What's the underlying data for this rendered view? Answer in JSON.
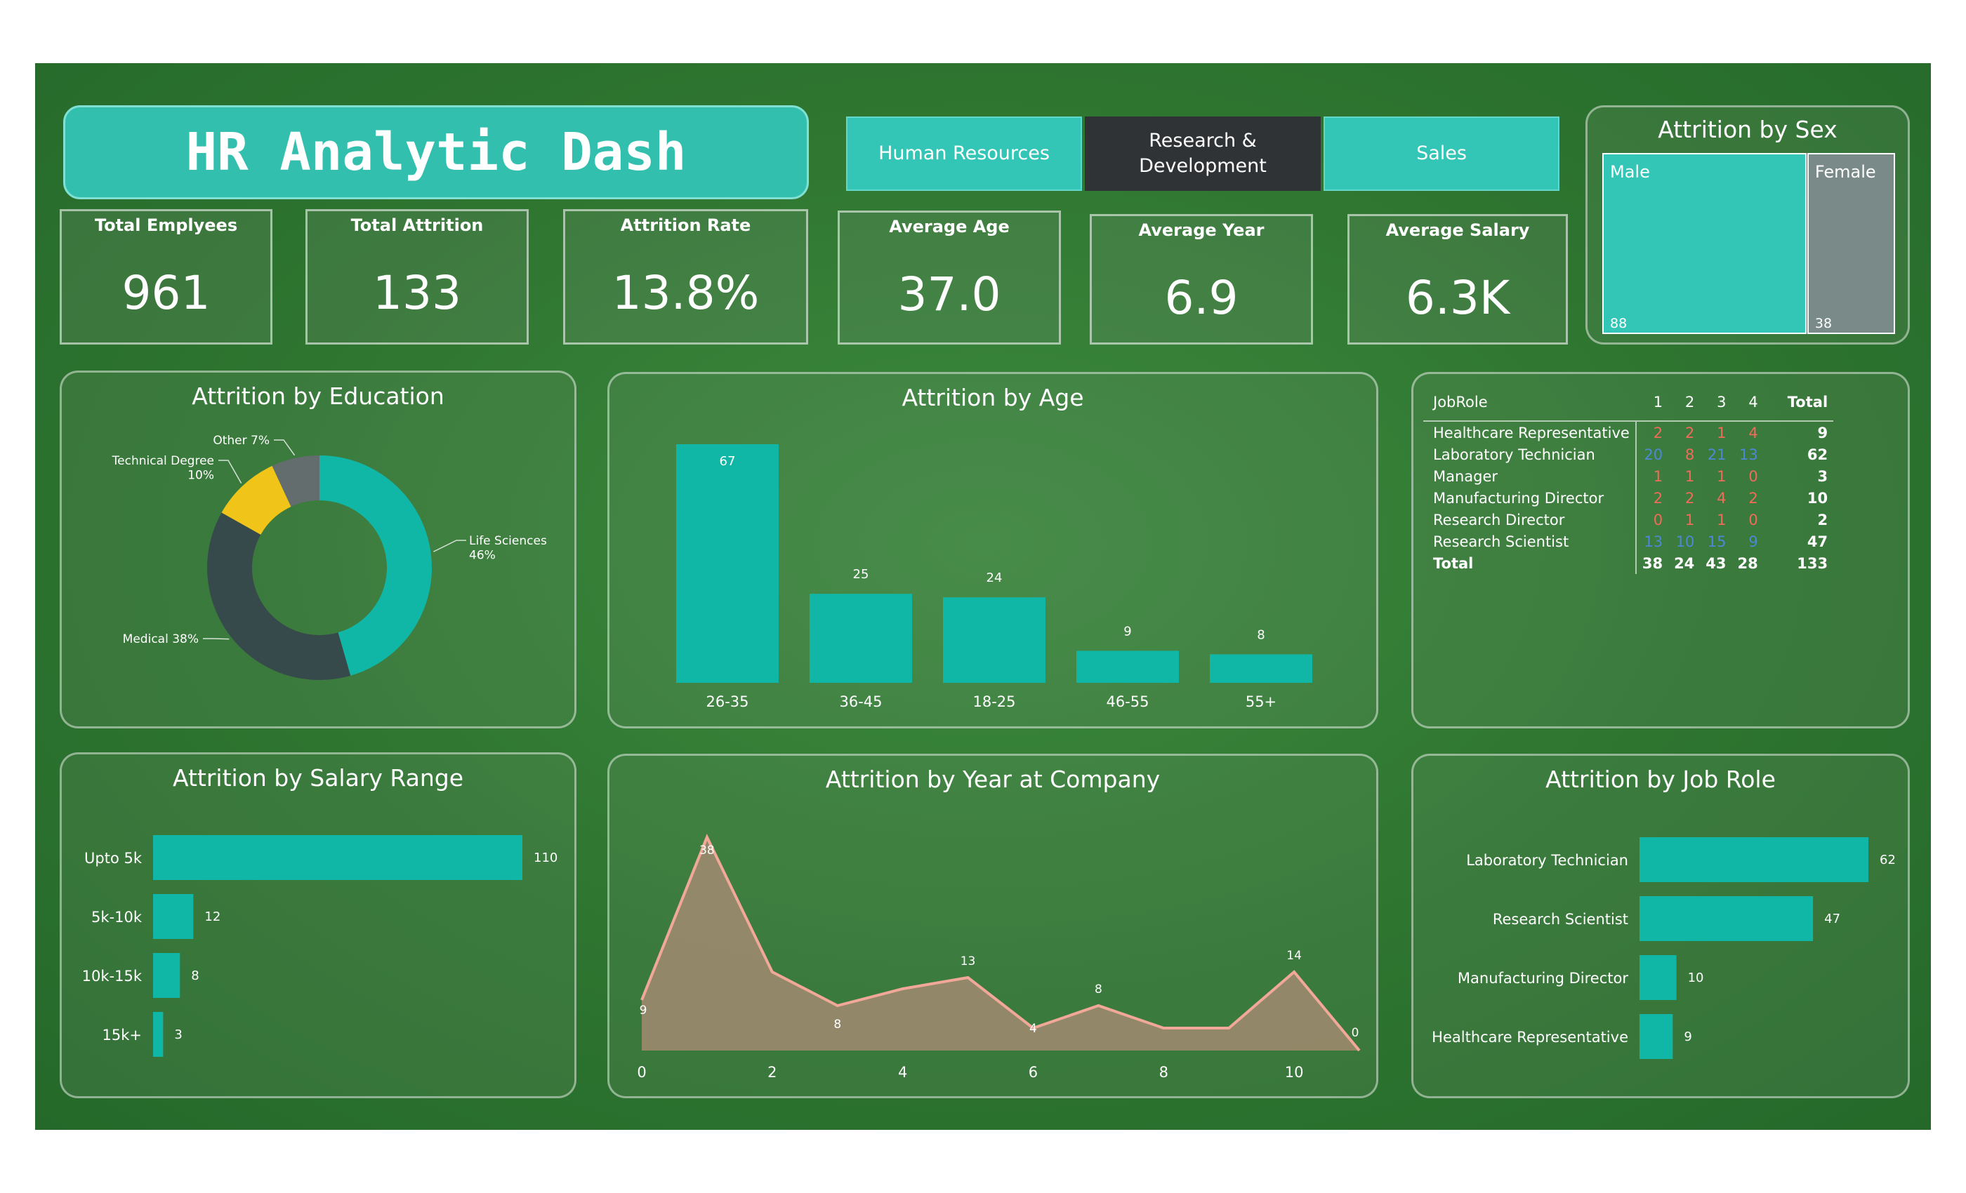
{
  "title": "HR Analytic Dash",
  "departments": [
    "Human Resources",
    "Research &\nDevelopment",
    "Sales"
  ],
  "colors": {
    "teal": "#11b7a6",
    "teal_light": "#33c6b6",
    "dark_button": "#2f3336",
    "grey": "#7a8a89",
    "line": "#f2a899",
    "area": "#9c8a6e"
  },
  "kpis": [
    {
      "label": "Total Emplyees",
      "value": "961"
    },
    {
      "label": "Total Attrition",
      "value": "133"
    },
    {
      "label": "Attrition Rate",
      "value": "13.8%"
    },
    {
      "label": "Average Age",
      "value": "37.0"
    },
    {
      "label": "Average Year",
      "value": "6.9"
    },
    {
      "label": "Average Salary",
      "value": "6.3K"
    }
  ],
  "chart_data": [
    {
      "type": "treemap",
      "title": "Attrition by Sex",
      "categories": [
        "Male",
        "Female"
      ],
      "values": [
        88,
        38
      ]
    },
    {
      "type": "pie",
      "title": "Attrition by Education",
      "categories": [
        "Life Sciences",
        "Medical",
        "Technical Degree",
        "Other"
      ],
      "values": [
        46,
        38,
        10,
        7
      ],
      "labels": [
        "Life Sciences\n46%",
        "Medical 38%",
        "Technical Degree\n10%",
        "Other 7%"
      ]
    },
    {
      "type": "bar",
      "title": "Attrition by Age",
      "categories": [
        "26-35",
        "36-45",
        "18-25",
        "46-55",
        "55+"
      ],
      "values": [
        67,
        25,
        24,
        9,
        8
      ]
    },
    {
      "type": "table",
      "columns": [
        "JobRole",
        "1",
        "2",
        "3",
        "4",
        "Total"
      ],
      "rows": [
        [
          "Healthcare Representative",
          "2",
          "2",
          "1",
          "4",
          "9"
        ],
        [
          "Laboratory Technician",
          "20",
          "8",
          "21",
          "13",
          "62"
        ],
        [
          "Manager",
          "1",
          "1",
          "1",
          "0",
          "3"
        ],
        [
          "Manufacturing Director",
          "2",
          "2",
          "4",
          "2",
          "10"
        ],
        [
          "Research Director",
          "0",
          "1",
          "1",
          "0",
          "2"
        ],
        [
          "Research Scientist",
          "13",
          "10",
          "15",
          "9",
          "47"
        ]
      ],
      "total_row": [
        "Total",
        "38",
        "24",
        "43",
        "28",
        "133"
      ]
    },
    {
      "type": "bar",
      "orientation": "horizontal",
      "title": "Attrition by Salary Range",
      "categories": [
        "Upto 5k",
        "5k-10k",
        "10k-15k",
        "15k+"
      ],
      "values": [
        110,
        12,
        8,
        3
      ]
    },
    {
      "type": "area",
      "title": "Attrition by Year at Company",
      "x": [
        0,
        1,
        2,
        3,
        4,
        5,
        6,
        7,
        8,
        9,
        10,
        11
      ],
      "y": [
        9,
        38,
        14,
        8,
        11,
        13,
        4,
        8,
        4,
        4,
        14,
        0
      ],
      "point_labels": [
        {
          "x": 0,
          "text": "9"
        },
        {
          "x": 1,
          "text": "38"
        },
        {
          "x": 3,
          "text": "8"
        },
        {
          "x": 5,
          "text": "13"
        },
        {
          "x": 6,
          "text": "4"
        },
        {
          "x": 7,
          "text": "8"
        },
        {
          "x": 10,
          "text": "14"
        },
        {
          "x": 11,
          "text": "0"
        }
      ],
      "xticks": [
        "0",
        "2",
        "4",
        "6",
        "8",
        "10"
      ],
      "xlim": [
        0,
        11
      ],
      "ylim": [
        0,
        40
      ]
    },
    {
      "type": "bar",
      "orientation": "horizontal",
      "title": "Attrition by Job Role",
      "categories": [
        "Laboratory Technician",
        "Research Scientist",
        "Manufacturing Director",
        "Healthcare Representative"
      ],
      "values": [
        62,
        47,
        10,
        9
      ]
    }
  ]
}
